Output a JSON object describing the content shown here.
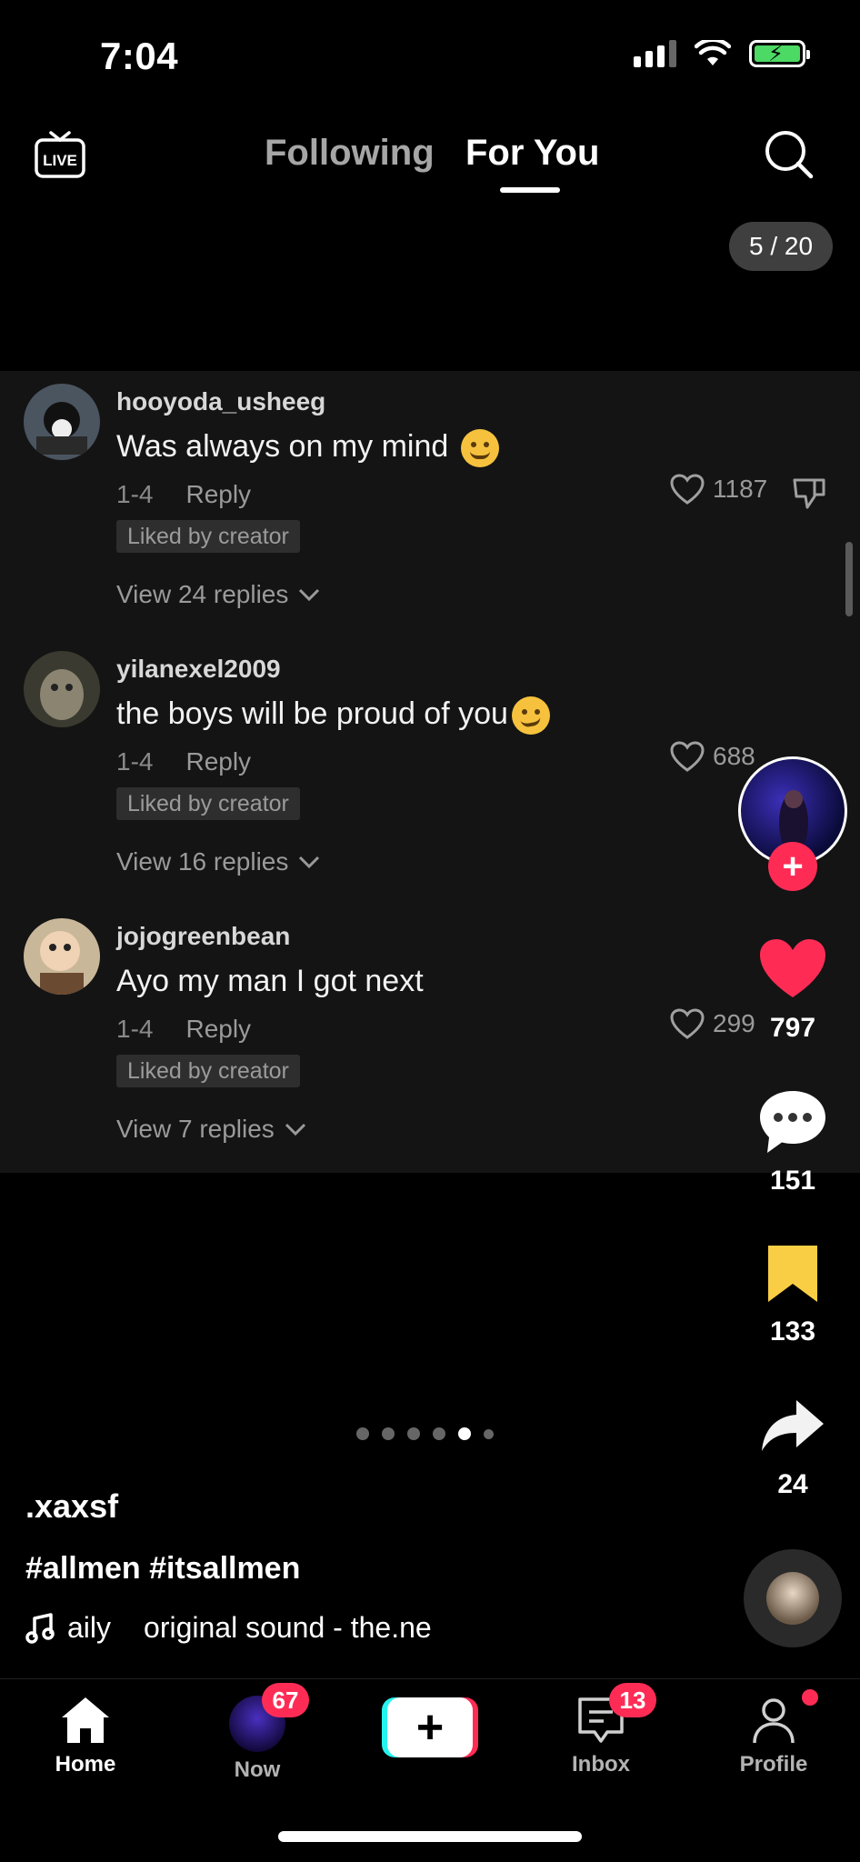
{
  "status_bar": {
    "time": "7:04"
  },
  "top_nav": {
    "live_label": "LIVE",
    "tabs": [
      {
        "label": "Following",
        "active": false
      },
      {
        "label": "For You",
        "active": true
      }
    ],
    "photo_counter": "5 / 20"
  },
  "comments": [
    {
      "username": "hooyoda_usheeg",
      "text": "Was always on my mind",
      "emoji": "sweat-smile",
      "date": "1-4",
      "reply_label": "Reply",
      "liked_badge": "Liked by creator",
      "likes": "1187",
      "view_replies": "View 24 replies"
    },
    {
      "username": "yilanexel2009",
      "text": "the boys will be proud of you",
      "emoji": "smirk",
      "date": "1-4",
      "reply_label": "Reply",
      "liked_badge": "Liked by creator",
      "likes": "688",
      "view_replies": "View 16 replies"
    },
    {
      "username": "jojogreenbean",
      "text": "Ayo my man I got next",
      "date": "1-4",
      "reply_label": "Reply",
      "liked_badge": "Liked by creator",
      "likes": "299",
      "view_replies": "View 7 replies"
    }
  ],
  "actions": {
    "likes": "797",
    "comments": "151",
    "saves": "133",
    "shares": "24",
    "like_color": "#fe2c55",
    "save_color": "#f9ce45"
  },
  "carousel": {
    "total": 6,
    "active_index": 4
  },
  "caption": {
    "username": ".xaxsf",
    "hashtags": "#allmen #itsallmen",
    "music_part1": "aily",
    "music_part2": "original sound - the.ne"
  },
  "bottom_nav": {
    "items": [
      {
        "label": "Home",
        "icon": "home-icon",
        "active": true
      },
      {
        "label": "Now",
        "icon": "now-avatar",
        "badge": "67"
      },
      {
        "label": "",
        "icon": "create-icon"
      },
      {
        "label": "Inbox",
        "icon": "inbox-icon",
        "badge": "13"
      },
      {
        "label": "Profile",
        "icon": "profile-icon"
      }
    ]
  },
  "colors": {
    "accent": "#fe2c55",
    "panel_bg": "#141414"
  }
}
